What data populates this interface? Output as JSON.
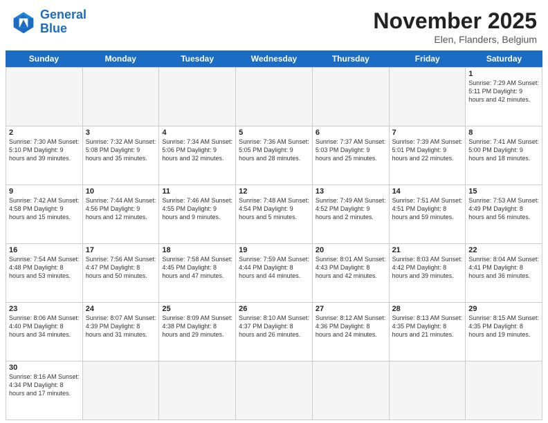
{
  "logo": {
    "line1": "General",
    "line2": "Blue"
  },
  "header": {
    "month": "November 2025",
    "location": "Elen, Flanders, Belgium"
  },
  "weekdays": [
    "Sunday",
    "Monday",
    "Tuesday",
    "Wednesday",
    "Thursday",
    "Friday",
    "Saturday"
  ],
  "days": [
    {
      "num": "",
      "info": "",
      "empty": true
    },
    {
      "num": "",
      "info": "",
      "empty": true
    },
    {
      "num": "",
      "info": "",
      "empty": true
    },
    {
      "num": "",
      "info": "",
      "empty": true
    },
    {
      "num": "",
      "info": "",
      "empty": true
    },
    {
      "num": "",
      "info": "",
      "empty": true
    },
    {
      "num": "1",
      "info": "Sunrise: 7:29 AM\nSunset: 5:11 PM\nDaylight: 9 hours\nand 42 minutes."
    },
    {
      "num": "2",
      "info": "Sunrise: 7:30 AM\nSunset: 5:10 PM\nDaylight: 9 hours\nand 39 minutes."
    },
    {
      "num": "3",
      "info": "Sunrise: 7:32 AM\nSunset: 5:08 PM\nDaylight: 9 hours\nand 35 minutes."
    },
    {
      "num": "4",
      "info": "Sunrise: 7:34 AM\nSunset: 5:06 PM\nDaylight: 9 hours\nand 32 minutes."
    },
    {
      "num": "5",
      "info": "Sunrise: 7:36 AM\nSunset: 5:05 PM\nDaylight: 9 hours\nand 28 minutes."
    },
    {
      "num": "6",
      "info": "Sunrise: 7:37 AM\nSunset: 5:03 PM\nDaylight: 9 hours\nand 25 minutes."
    },
    {
      "num": "7",
      "info": "Sunrise: 7:39 AM\nSunset: 5:01 PM\nDaylight: 9 hours\nand 22 minutes."
    },
    {
      "num": "8",
      "info": "Sunrise: 7:41 AM\nSunset: 5:00 PM\nDaylight: 9 hours\nand 18 minutes."
    },
    {
      "num": "9",
      "info": "Sunrise: 7:42 AM\nSunset: 4:58 PM\nDaylight: 9 hours\nand 15 minutes."
    },
    {
      "num": "10",
      "info": "Sunrise: 7:44 AM\nSunset: 4:56 PM\nDaylight: 9 hours\nand 12 minutes."
    },
    {
      "num": "11",
      "info": "Sunrise: 7:46 AM\nSunset: 4:55 PM\nDaylight: 9 hours\nand 9 minutes."
    },
    {
      "num": "12",
      "info": "Sunrise: 7:48 AM\nSunset: 4:54 PM\nDaylight: 9 hours\nand 5 minutes."
    },
    {
      "num": "13",
      "info": "Sunrise: 7:49 AM\nSunset: 4:52 PM\nDaylight: 9 hours\nand 2 minutes."
    },
    {
      "num": "14",
      "info": "Sunrise: 7:51 AM\nSunset: 4:51 PM\nDaylight: 8 hours\nand 59 minutes."
    },
    {
      "num": "15",
      "info": "Sunrise: 7:53 AM\nSunset: 4:49 PM\nDaylight: 8 hours\nand 56 minutes."
    },
    {
      "num": "16",
      "info": "Sunrise: 7:54 AM\nSunset: 4:48 PM\nDaylight: 8 hours\nand 53 minutes."
    },
    {
      "num": "17",
      "info": "Sunrise: 7:56 AM\nSunset: 4:47 PM\nDaylight: 8 hours\nand 50 minutes."
    },
    {
      "num": "18",
      "info": "Sunrise: 7:58 AM\nSunset: 4:45 PM\nDaylight: 8 hours\nand 47 minutes."
    },
    {
      "num": "19",
      "info": "Sunrise: 7:59 AM\nSunset: 4:44 PM\nDaylight: 8 hours\nand 44 minutes."
    },
    {
      "num": "20",
      "info": "Sunrise: 8:01 AM\nSunset: 4:43 PM\nDaylight: 8 hours\nand 42 minutes."
    },
    {
      "num": "21",
      "info": "Sunrise: 8:03 AM\nSunset: 4:42 PM\nDaylight: 8 hours\nand 39 minutes."
    },
    {
      "num": "22",
      "info": "Sunrise: 8:04 AM\nSunset: 4:41 PM\nDaylight: 8 hours\nand 36 minutes."
    },
    {
      "num": "23",
      "info": "Sunrise: 8:06 AM\nSunset: 4:40 PM\nDaylight: 8 hours\nand 34 minutes."
    },
    {
      "num": "24",
      "info": "Sunrise: 8:07 AM\nSunset: 4:39 PM\nDaylight: 8 hours\nand 31 minutes."
    },
    {
      "num": "25",
      "info": "Sunrise: 8:09 AM\nSunset: 4:38 PM\nDaylight: 8 hours\nand 29 minutes."
    },
    {
      "num": "26",
      "info": "Sunrise: 8:10 AM\nSunset: 4:37 PM\nDaylight: 8 hours\nand 26 minutes."
    },
    {
      "num": "27",
      "info": "Sunrise: 8:12 AM\nSunset: 4:36 PM\nDaylight: 8 hours\nand 24 minutes."
    },
    {
      "num": "28",
      "info": "Sunrise: 8:13 AM\nSunset: 4:35 PM\nDaylight: 8 hours\nand 21 minutes."
    },
    {
      "num": "29",
      "info": "Sunrise: 8:15 AM\nSunset: 4:35 PM\nDaylight: 8 hours\nand 19 minutes."
    },
    {
      "num": "30",
      "info": "Sunrise: 8:16 AM\nSunset: 4:34 PM\nDaylight: 8 hours\nand 17 minutes."
    },
    {
      "num": "",
      "info": "",
      "empty": true
    },
    {
      "num": "",
      "info": "",
      "empty": true
    },
    {
      "num": "",
      "info": "",
      "empty": true
    },
    {
      "num": "",
      "info": "",
      "empty": true
    },
    {
      "num": "",
      "info": "",
      "empty": true
    },
    {
      "num": "",
      "info": "",
      "empty": true
    }
  ]
}
